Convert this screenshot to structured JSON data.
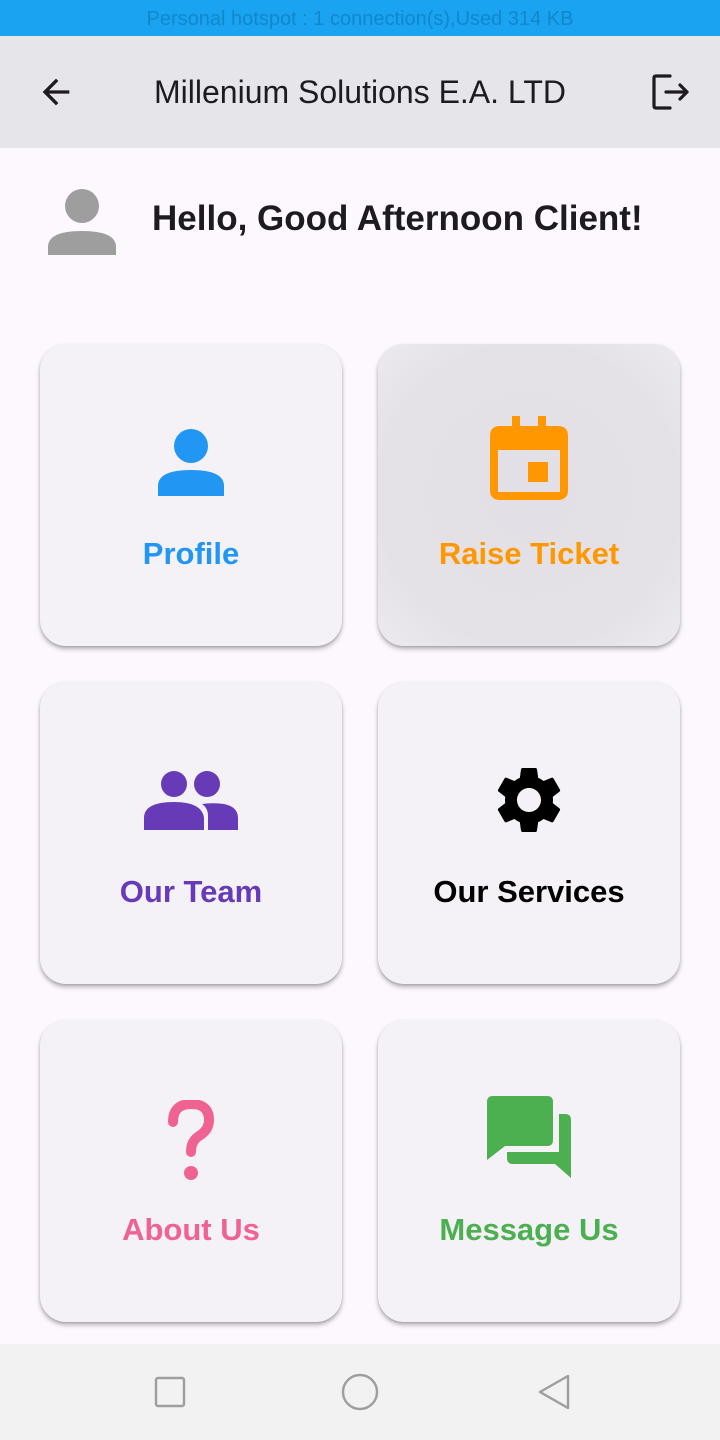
{
  "status_bar": {
    "text": "Personal hotspot : 1 connection(s),Used  314 KB"
  },
  "app_bar": {
    "title": "Millenium Solutions E.A. LTD",
    "back_icon": "arrow-back-icon",
    "logout_icon": "logout-icon"
  },
  "greeting": {
    "text": "Hello, Good Afternoon Client!",
    "avatar_icon": "person-icon"
  },
  "cards": [
    {
      "label": "Profile",
      "icon": "person-icon",
      "color": "#2196f3"
    },
    {
      "label": "Raise Ticket",
      "icon": "calendar-event-icon",
      "color": "#ff9800"
    },
    {
      "label": "Our Team",
      "icon": "people-icon",
      "color": "#673ab7"
    },
    {
      "label": "Our Services",
      "icon": "gear-icon",
      "color": "#000000"
    },
    {
      "label": "About Us",
      "icon": "question-mark-icon",
      "color": "#f06292"
    },
    {
      "label": "Message Us",
      "icon": "chat-bubbles-icon",
      "color": "#4caf50"
    }
  ],
  "nav_bar": {
    "recents_icon": "square-icon",
    "home_icon": "circle-icon",
    "back_icon": "triangle-back-icon"
  },
  "colors": {
    "status_bar": "#1aa3f0",
    "app_bar": "#e6e5ea",
    "background": "#fdf7fe",
    "card": "#f4f1f7"
  }
}
